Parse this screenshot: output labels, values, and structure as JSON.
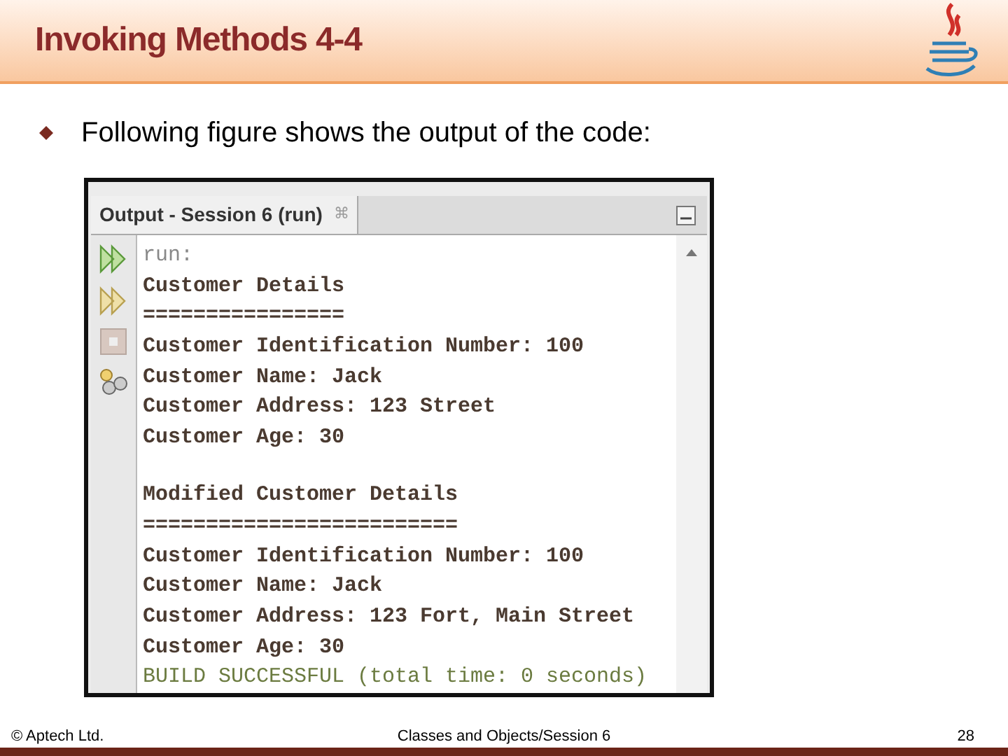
{
  "slide": {
    "title": "Invoking Methods 4-4",
    "bullet": "Following figure shows the output of the code:"
  },
  "output_window": {
    "tab": {
      "label": "Output - Session 6 (run)",
      "close": "⌘"
    },
    "lines": [
      {
        "kind": "muted",
        "text": "run:"
      },
      {
        "kind": "plain",
        "text": "Customer Details"
      },
      {
        "kind": "plain",
        "text": "================"
      },
      {
        "kind": "plain",
        "text": "Customer Identification Number: 100"
      },
      {
        "kind": "plain",
        "text": "Customer Name: Jack"
      },
      {
        "kind": "plain",
        "text": "Customer Address: 123 Street"
      },
      {
        "kind": "plain",
        "text": "Customer Age: 30"
      },
      {
        "kind": "blank"
      },
      {
        "kind": "plain",
        "text": "Modified Customer Details"
      },
      {
        "kind": "plain",
        "text": "========================="
      },
      {
        "kind": "plain",
        "text": "Customer Identification Number: 100"
      },
      {
        "kind": "plain",
        "text": "Customer Name: Jack"
      },
      {
        "kind": "plain",
        "text": "Customer Address: 123 Fort, Main Street"
      },
      {
        "kind": "plain",
        "text": "Customer Age: 30"
      },
      {
        "kind": "success",
        "text": "BUILD SUCCESSFUL (total time: 0 seconds)"
      }
    ]
  },
  "footer": {
    "left": "© Aptech Ltd.",
    "center": "Classes and Objects/Session 6",
    "page": "28"
  }
}
